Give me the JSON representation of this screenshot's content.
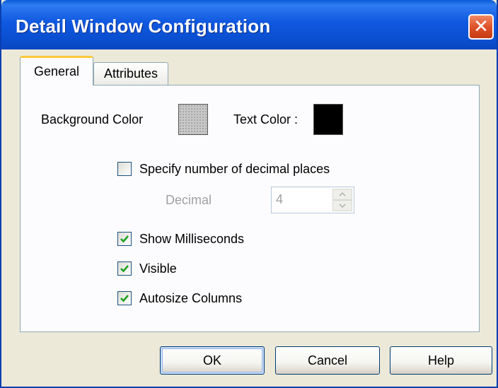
{
  "window": {
    "title": "Detail Window Configuration",
    "close_glyph": "✕"
  },
  "tabs": [
    {
      "label": "General",
      "active": true
    },
    {
      "label": "Attributes",
      "active": false
    }
  ],
  "general": {
    "background_color_label": "Background Color",
    "text_color_label": "Text Color :",
    "background_color_value": "#c8c8c8",
    "text_color_value": "#000000",
    "specify_decimal": {
      "label": "Specify number of decimal places",
      "checked": false
    },
    "decimal": {
      "label": "Decimal",
      "value": "4",
      "disabled": true
    },
    "show_milliseconds": {
      "label": "Show Milliseconds",
      "checked": true
    },
    "visible": {
      "label": "Visible",
      "checked": true
    },
    "autosize_columns": {
      "label": "Autosize Columns",
      "checked": true
    }
  },
  "buttons": {
    "ok": "OK",
    "cancel": "Cancel",
    "help": "Help"
  },
  "icons": {
    "close": "close-icon",
    "check": "checkmark-icon",
    "spin_up": "arrow-up-icon",
    "spin_down": "arrow-down-icon"
  },
  "colors": {
    "title_bar": "#0a4fd0",
    "dialog_bg": "#ece9d8",
    "active_tab_accent": "#ffc83c",
    "checkmark": "#21a121",
    "disabled_text": "#a0a0a0"
  }
}
